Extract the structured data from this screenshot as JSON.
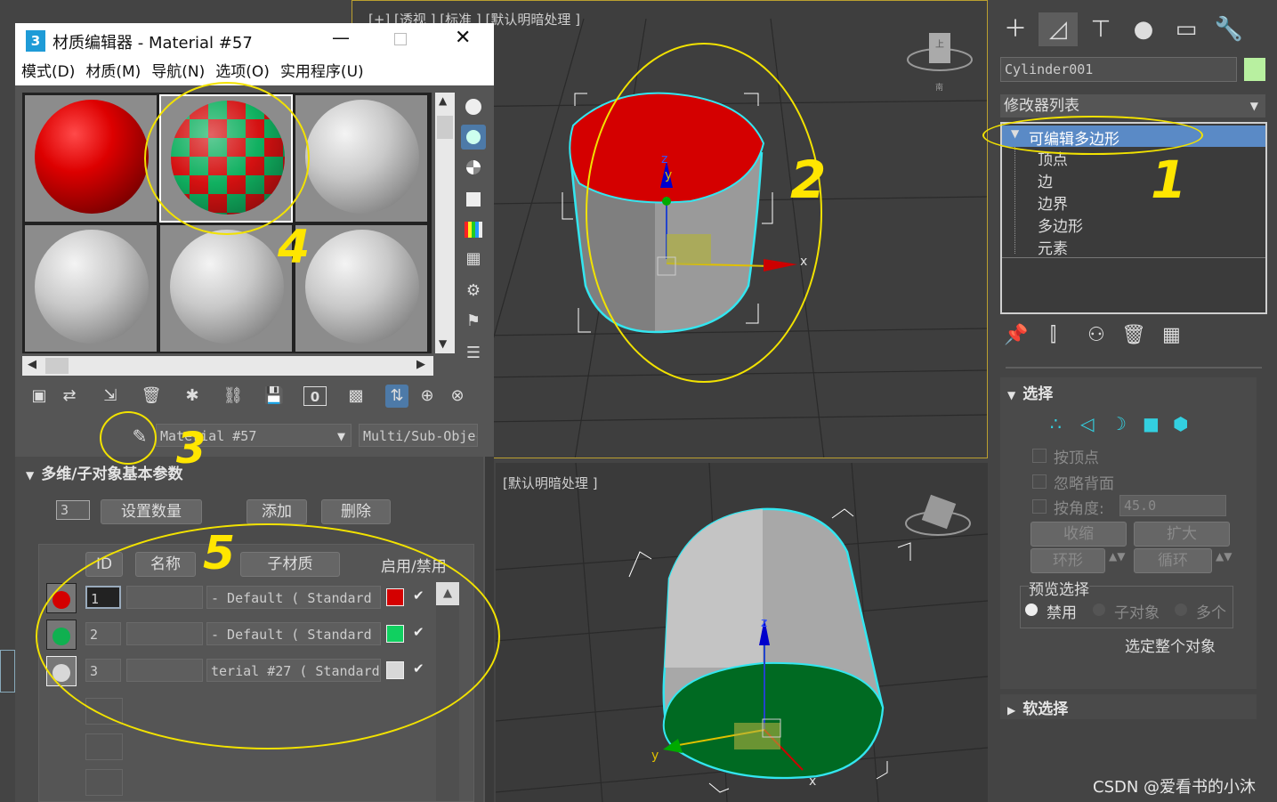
{
  "viewport_top": {
    "label": "[+] [透视 ] [标准 ] [默认明暗处理 ]"
  },
  "viewport_bottom": {
    "label": "[默认明暗处理 ]"
  },
  "axes": {
    "x": "x",
    "y": "y",
    "z": "z"
  },
  "material_editor": {
    "title": "材质编辑器 - Material #57",
    "app_icon": "3",
    "menu": [
      "模式(D)",
      "材质(M)",
      "导航(N)",
      "选项(O)",
      "实用程序(U)"
    ],
    "material_name": "Material #57",
    "material_type": "Multi/Sub-Objec",
    "rollout_title": "多维/子对象基本参数",
    "count_value": "3",
    "buttons": {
      "set_count": "设置数量",
      "add": "添加",
      "delete": "删除"
    },
    "table": {
      "headers": {
        "id": "ID",
        "name": "名称",
        "submaterial": "子材质",
        "enable": "启用/禁用"
      },
      "rows": [
        {
          "id": "1",
          "name": "",
          "submaterial": "- Default  ( Standard",
          "color": "#d40000",
          "enabled": "✔"
        },
        {
          "id": "2",
          "name": "",
          "submaterial": "- Default  ( Standard",
          "color": "#10d060",
          "enabled": "✔"
        },
        {
          "id": "3",
          "name": "",
          "submaterial": "terial #27  ( Standard",
          "color": "#d8d8d8",
          "enabled": "✔"
        }
      ]
    }
  },
  "command_panel": {
    "object_name": "Cylinder001",
    "object_color": "#b8f0a0",
    "modifier_list": "修改器列表",
    "stack_top": "可编辑多边形",
    "stack_items": [
      "顶点",
      "边",
      "边界",
      "多边形",
      "元素"
    ],
    "selection": {
      "header": "选择",
      "by_vertex": "按顶点",
      "ignore_backfacing": "忽略背面",
      "by_angle": "按角度:",
      "angle_value": "45.0",
      "shrink": "收缩",
      "grow": "扩大",
      "ring": "环形",
      "loop": "循环",
      "preview_group": "预览选择",
      "preview_options": [
        "禁用",
        "子对象",
        "多个"
      ],
      "whole_object": "选定整个对象"
    },
    "soft_selection": "软选择"
  },
  "annotations": [
    "1",
    "2",
    "3",
    "4",
    "5"
  ],
  "watermark": "CSDN @爱看书的小沐"
}
